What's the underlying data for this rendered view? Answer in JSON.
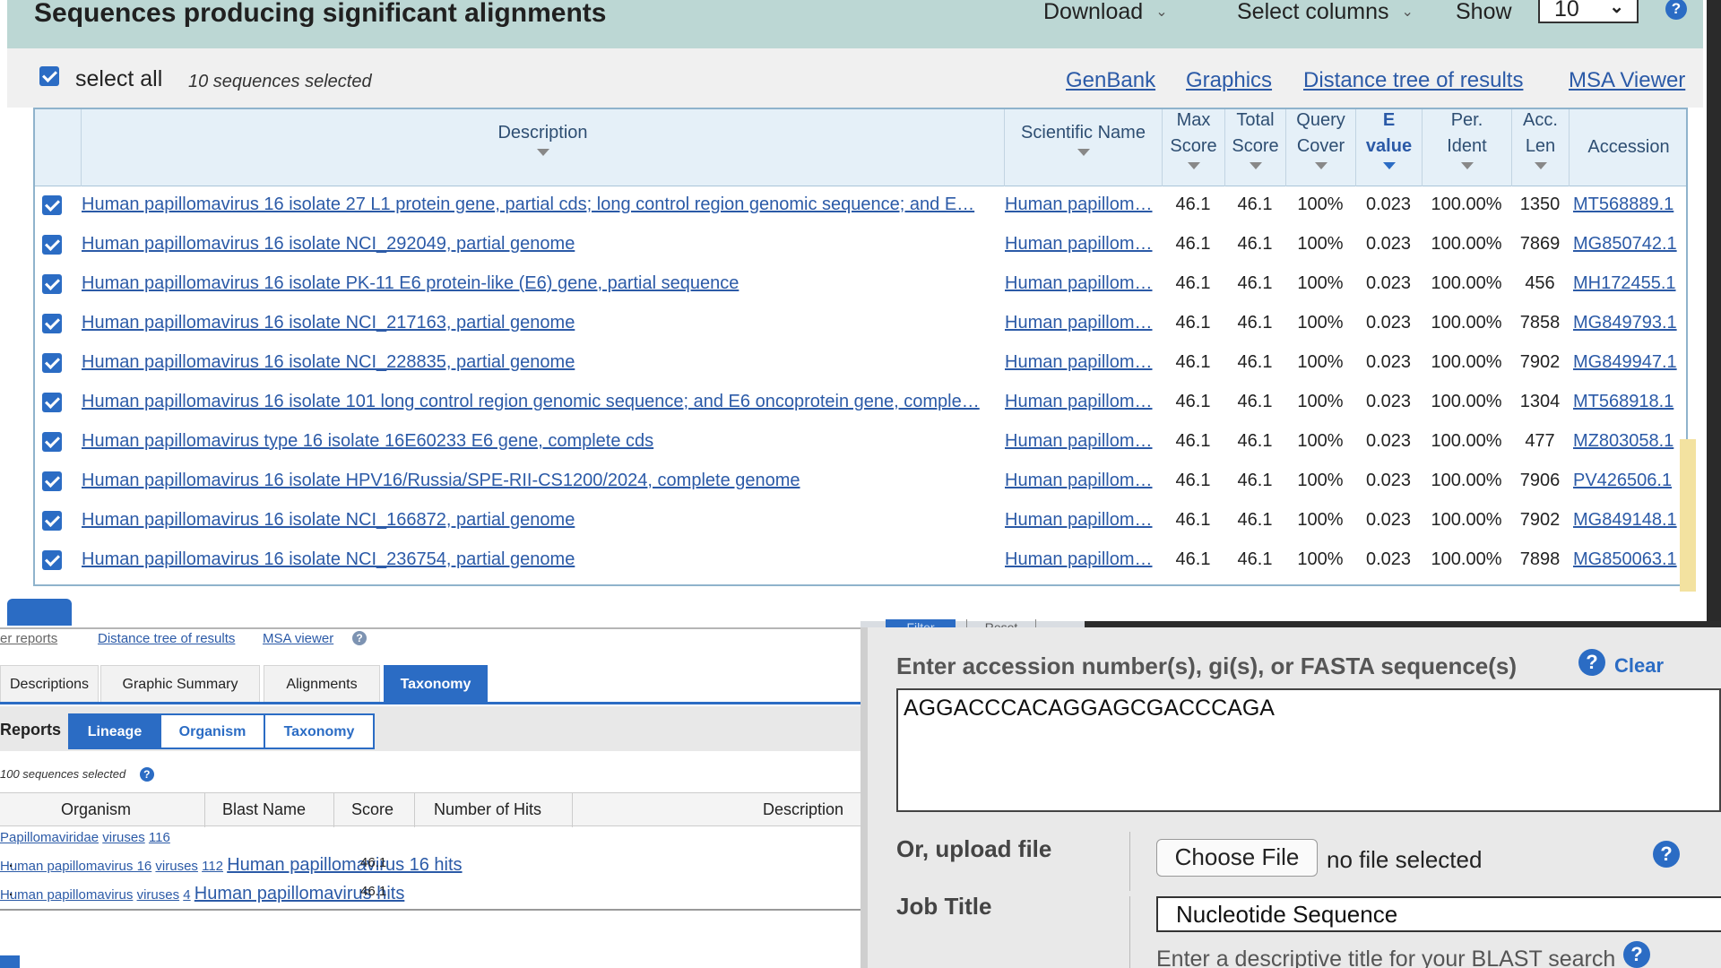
{
  "header": {
    "title": "Sequences producing significant alignments",
    "download_label": "Download",
    "select_columns_label": "Select columns",
    "show_label": "Show",
    "show_value": "10",
    "help_glyph": "?"
  },
  "selection": {
    "select_all_label": "select all",
    "count_text": "10 sequences selected",
    "links": [
      "GenBank",
      "Graphics",
      "Distance tree of results",
      "MSA Viewer"
    ]
  },
  "table": {
    "columns": {
      "description": "Description",
      "scientific_name": "Scientific Name",
      "max_score": [
        "Max",
        "Score"
      ],
      "total_score": [
        "Total",
        "Score"
      ],
      "query_cover": [
        "Query",
        "Cover"
      ],
      "e_value": [
        "E",
        "value"
      ],
      "per_ident": [
        "Per.",
        "Ident"
      ],
      "acc_len": [
        "Acc.",
        "Len"
      ],
      "accession": "Accession"
    },
    "rows": [
      {
        "description": "Human papillomavirus 16 isolate 27 L1 protein gene, partial cds; long control region genomic sequence; and E…",
        "scientific_name": "Human papillom…",
        "max_score": "46.1",
        "total_score": "46.1",
        "query_cover": "100%",
        "e_value": "0.023",
        "per_ident": "100.00%",
        "acc_len": "1350",
        "accession": "MT568889.1"
      },
      {
        "description": "Human papillomavirus 16 isolate NCI_292049, partial genome",
        "scientific_name": "Human papillom…",
        "max_score": "46.1",
        "total_score": "46.1",
        "query_cover": "100%",
        "e_value": "0.023",
        "per_ident": "100.00%",
        "acc_len": "7869",
        "accession": "MG850742.1"
      },
      {
        "description": "Human papillomavirus 16 isolate PK-11 E6 protein-like (E6) gene, partial sequence",
        "scientific_name": "Human papillom…",
        "max_score": "46.1",
        "total_score": "46.1",
        "query_cover": "100%",
        "e_value": "0.023",
        "per_ident": "100.00%",
        "acc_len": "456",
        "accession": "MH172455.1"
      },
      {
        "description": "Human papillomavirus 16 isolate NCI_217163, partial genome",
        "scientific_name": "Human papillom…",
        "max_score": "46.1",
        "total_score": "46.1",
        "query_cover": "100%",
        "e_value": "0.023",
        "per_ident": "100.00%",
        "acc_len": "7858",
        "accession": "MG849793.1"
      },
      {
        "description": "Human papillomavirus 16 isolate NCI_228835, partial genome",
        "scientific_name": "Human papillom…",
        "max_score": "46.1",
        "total_score": "46.1",
        "query_cover": "100%",
        "e_value": "0.023",
        "per_ident": "100.00%",
        "acc_len": "7902",
        "accession": "MG849947.1"
      },
      {
        "description": "Human papillomavirus 16 isolate 101 long control region genomic sequence; and E6 oncoprotein gene, comple…",
        "scientific_name": "Human papillom…",
        "max_score": "46.1",
        "total_score": "46.1",
        "query_cover": "100%",
        "e_value": "0.023",
        "per_ident": "100.00%",
        "acc_len": "1304",
        "accession": "MT568918.1"
      },
      {
        "description": "Human papillomavirus type 16 isolate 16E60233 E6 gene, complete cds",
        "scientific_name": "Human papillom…",
        "max_score": "46.1",
        "total_score": "46.1",
        "query_cover": "100%",
        "e_value": "0.023",
        "per_ident": "100.00%",
        "acc_len": "477",
        "accession": "MZ803058.1"
      },
      {
        "description": "Human papillomavirus 16 isolate HPV16/Russia/SPE-RII-CS1200/2024, complete genome",
        "scientific_name": "Human papillom…",
        "max_score": "46.1",
        "total_score": "46.1",
        "query_cover": "100%",
        "e_value": "0.023",
        "per_ident": "100.00%",
        "acc_len": "7906",
        "accession": "PV426506.1"
      },
      {
        "description": "Human papillomavirus 16 isolate NCI_166872, partial genome",
        "scientific_name": "Human papillom…",
        "max_score": "46.1",
        "total_score": "46.1",
        "query_cover": "100%",
        "e_value": "0.023",
        "per_ident": "100.00%",
        "acc_len": "7902",
        "accession": "MG849148.1"
      },
      {
        "description": "Human papillomavirus 16 isolate NCI_236754, partial genome",
        "scientific_name": "Human papillom…",
        "max_score": "46.1",
        "total_score": "46.1",
        "query_cover": "100%",
        "e_value": "0.023",
        "per_ident": "100.00%",
        "acc_len": "7898",
        "accession": "MG850063.1"
      }
    ]
  },
  "lower_left": {
    "links": [
      "er reports",
      "Distance tree of results",
      "MSA viewer"
    ],
    "tabs": [
      "Descriptions",
      "Graphic Summary",
      "Alignments",
      "Taxonomy"
    ],
    "active_tab": "Taxonomy",
    "reports_label": "Reports",
    "report_buttons": [
      "Lineage",
      "Organism",
      "Taxonomy"
    ],
    "count_text": "100 sequences selected",
    "columns": [
      "Organism",
      "Blast Name",
      "Score",
      "Number of Hits",
      "Description"
    ],
    "rows": [
      {
        "organism": "Papillomaviridae",
        "blast_name": "viruses",
        "score": "",
        "hits": "116",
        "description": ""
      },
      {
        "organism": "Human papillomavirus 16",
        "blast_name": "viruses",
        "score": "46.1",
        "hits": "112",
        "description": "Human papillomavirus 16 hits"
      },
      {
        "organism": "Human papillomavirus",
        "blast_name": "viruses",
        "score": "46.1",
        "hits": "4",
        "description": "Human papillomavirus hits"
      }
    ],
    "bullet": "."
  },
  "lower_right": {
    "filter_label": "Filter",
    "reset_label": "Reset",
    "seq_label": "Enter accession number(s), gi(s), or FASTA sequence(s)",
    "clear_label": "Clear",
    "sequence_value": "AGGACCCACAGGAGCGACCCAGA",
    "upload_label": "Or, upload file",
    "choose_file_label": "Choose File",
    "no_file_text": "no file selected",
    "job_title_label": "Job Title",
    "job_title_value": "Nucleotide Sequence",
    "job_title_hint": "Enter a descriptive title for your BLAST search"
  },
  "colors": {
    "header_bg": "#bcd7d4",
    "link": "#2b5aa7",
    "accent": "#2b6cc4"
  }
}
